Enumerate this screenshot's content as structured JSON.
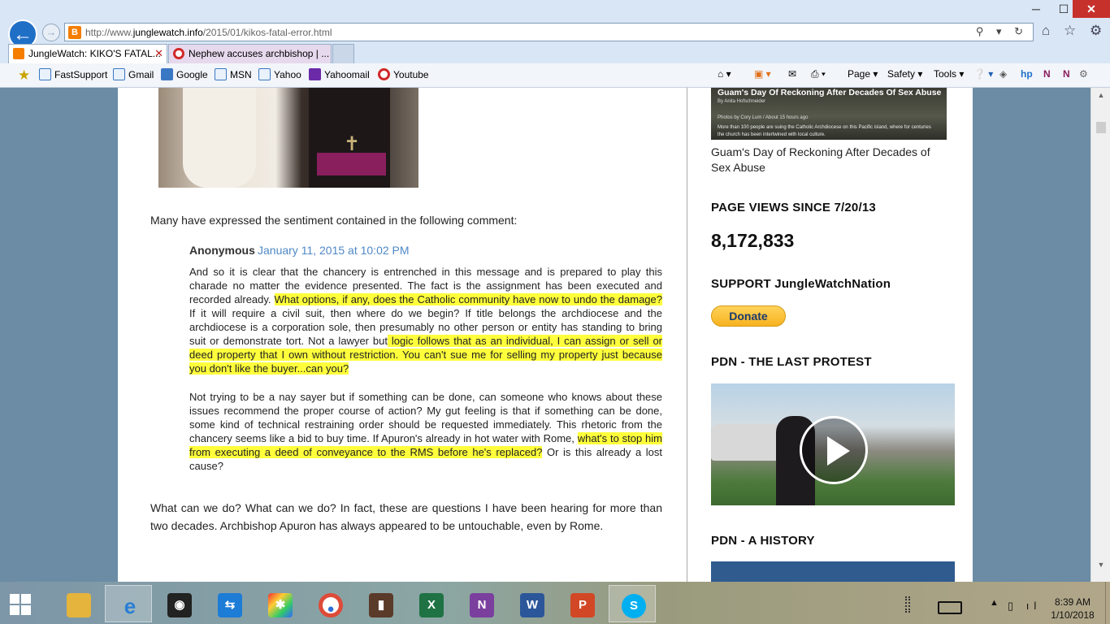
{
  "window": {
    "minimize": "─",
    "maximize": "☐",
    "close": "✕"
  },
  "nav": {
    "back": "←",
    "forward": "→",
    "url_prefix": "http://www.",
    "url_domain": "junglewatch.info",
    "url_path": "/2015/01/kikos-fatal-error.html",
    "address_icons": "⚲ ▾ ↻",
    "right_icons": "⌂ ☆ ⚙"
  },
  "tabs": [
    {
      "label": "JungleWatch: KIKO'S FATAL...",
      "close": "✕",
      "active": true
    },
    {
      "label": "Nephew accuses archbishop | ...",
      "active": false
    }
  ],
  "favorites": {
    "items": [
      {
        "label": "FastSupport",
        "icon": "ie-page-icon",
        "color": "#3b78c4"
      },
      {
        "label": "Gmail",
        "icon": "ie-page-icon",
        "color": "#3b78c4"
      },
      {
        "label": "Google",
        "icon": "google-icon",
        "color": "#3b78c4"
      },
      {
        "label": "MSN",
        "icon": "ie-page-icon",
        "color": "#3b78c4"
      },
      {
        "label": "Yahoo",
        "icon": "ie-page-icon",
        "color": "#3b78c4"
      },
      {
        "label": "Yahoomail",
        "icon": "yahoo-icon",
        "color": "#6b2aa8"
      },
      {
        "label": "Youtube",
        "icon": "opera-icon",
        "color": "#d02828"
      }
    ],
    "commands": {
      "home": "⌂ ▾",
      "feeds": "▣ ▾",
      "mail": "✉",
      "print": "⎙ ▾",
      "page": "Page ▾",
      "safety": "Safety ▾",
      "tools": "Tools ▾",
      "help": "❔ ▾"
    }
  },
  "post": {
    "intro": "Many have expressed the sentiment contained in the following comment:",
    "comment": {
      "author": "Anonymous",
      "date": "January 11, 2015 at 10:02 PM",
      "p1_a": "And so it is clear that the chancery is entrenched in this message and is prepared to play this charade no matter the evidence presented. The fact is the assignment has been executed and recorded already. ",
      "p1_hl1": "What options, if any, does the Catholic community have now to undo the damage? ",
      "p1_b": "If it will require a civil suit, then where do we begin? If title belongs the archdiocese and the archdiocese is a corporation sole, then presumably no other person or entity has standing to bring suit or demonstrate tort. Not a lawyer but",
      "p1_hl2": " logic follows that as an individual, I can assign or sell or deed property that I own without restriction. You can't sue me for selling my property just because you don't like the buyer...can you?",
      "p2_a": "Not trying to be a nay sayer but if something can be done, can someone who knows about these issues recommend the proper course of action? My gut feeling is that if something can be done, some kind of technical restraining order should be requested immediately. This rhetoric from the chancery seems like a bid to buy time. If Apuron's already in hot water with Rome, ",
      "p2_hl": "what's to stop him from executing a deed of conveyance to the RMS before he's replaced?",
      "p2_b": " Or is this already a lost cause?"
    },
    "closing": "What can we do? What can we do? In fact, these are questions I have been hearing for more than two decades. Archbishop Apuron has always appeared to be untouchable, even by Rome."
  },
  "sidebar": {
    "news_thumb_title": "Guam's Day Of Reckoning After Decades Of Sex Abuse",
    "news_thumb_meta": "By Anita Hofschneider",
    "news_thumb_credit": "Photos by Cory Lum / About 15 hours ago",
    "news_thumb_desc": "More than 100 people are suing the Catholic Archdiocese on this Pacific island, where for centuries the church has been intertwined with local culture.",
    "news_caption": "Guam's Day of Reckoning After Decades of Sex Abuse",
    "pageviews_heading": "PAGE VIEWS SINCE 7/20/13",
    "pageviews_count": "8,172,833",
    "support_heading": "SUPPORT JungleWatchNation",
    "donate_label": "Donate",
    "protest_heading": "PDN - THE LAST PROTEST",
    "history_heading": "PDN - A HISTORY"
  },
  "scrollbar": {
    "up": "▲",
    "down": "▼"
  },
  "taskbar": {
    "apps": [
      {
        "name": "file-explorer",
        "label": "",
        "color": "#e5b43c"
      },
      {
        "name": "internet-explorer",
        "label": "e",
        "color": "#2a7fd4",
        "active": true
      },
      {
        "name": "webcam",
        "label": "◉",
        "color": "#222"
      },
      {
        "name": "teamviewer",
        "label": "⇆",
        "color": "#1d7cd6"
      },
      {
        "name": "photo-app",
        "label": "✱",
        "color": "#444"
      },
      {
        "name": "chrome",
        "label": "●",
        "color": "#dd4b39"
      },
      {
        "name": "book-app",
        "label": "▮",
        "color": "#5a3a28"
      },
      {
        "name": "excel",
        "label": "X",
        "color": "#1f7244"
      },
      {
        "name": "onenote",
        "label": "N",
        "color": "#7b3f9e"
      },
      {
        "name": "word",
        "label": "W",
        "color": "#2b579a"
      },
      {
        "name": "powerpoint",
        "label": "P",
        "color": "#d24726"
      },
      {
        "name": "skype",
        "label": "S",
        "color": "#00aff0",
        "active": true
      }
    ],
    "tray_up": "▲",
    "tray_icons": "▯ ıl",
    "time": "8:39 AM",
    "date": "1/10/2018"
  }
}
